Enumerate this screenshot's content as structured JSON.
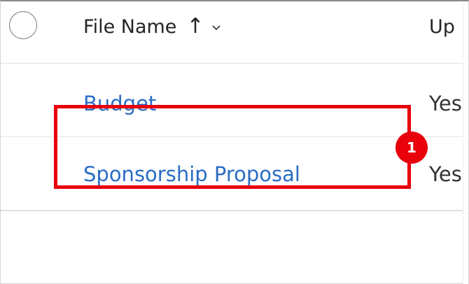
{
  "table": {
    "columns": {
      "file_name": "File Name",
      "uploaded": "Up",
      "sort_arrow": "↑"
    },
    "rows": [
      {
        "file_name": "Budget",
        "uploaded": "Yes"
      },
      {
        "file_name": "Sponsorship Proposal",
        "uploaded": "Yes"
      }
    ]
  },
  "annotation": {
    "step_number": "1",
    "color": "#e8000b"
  },
  "colors": {
    "link": "#2b6cc4",
    "header_text": "#242424"
  },
  "icons": {
    "select_all": "circle-checkbox-icon",
    "sort": "arrow-up-icon",
    "menu": "chevron-down-icon"
  }
}
